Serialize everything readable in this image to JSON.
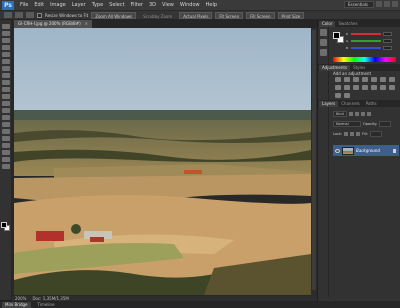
{
  "app": {
    "logo_text": "Ps",
    "menu": [
      "File",
      "Edit",
      "Image",
      "Layer",
      "Type",
      "Select",
      "Filter",
      "3D",
      "View",
      "Window",
      "Help"
    ],
    "workspace": "Essentials"
  },
  "options_bar": {
    "checkbox_label": "Resize Windows to Fit",
    "zoom_all_windows": "Zoom All Windows",
    "scrubby_zoom": "Scrubby Zoom",
    "actual_pixels": "Actual Pixels",
    "fit_screen": "Fit Screen",
    "fill_screen": "Fill Screen",
    "print_size": "Print Size"
  },
  "document": {
    "tab_label": "GI-CRH-I.jpg @ 200% (RGB/8#)",
    "close_glyph": "×",
    "zoom": "200%",
    "doc_info": "Doc: 1,35M/1,35M"
  },
  "bottom_bar": {
    "tabs": [
      "Mini Bridge",
      "Timeline"
    ]
  },
  "panels": {
    "color": {
      "tabs": [
        "Color",
        "Swatches"
      ],
      "channels": [
        {
          "label": "R",
          "color": "#d03030"
        },
        {
          "label": "G",
          "color": "#30a030"
        },
        {
          "label": "B",
          "color": "#3050d0"
        }
      ]
    },
    "adjustments": {
      "tabs": [
        "Adjustments",
        "Styles"
      ],
      "title": "Add an adjustment"
    },
    "layers": {
      "tabs": [
        "Layers",
        "Channels",
        "Paths"
      ],
      "kind": "Kind",
      "blend_mode": "Normal",
      "opacity_label": "Opacity:",
      "lock_label": "Lock:",
      "fill_label": "Fill:",
      "background_layer": "Background"
    }
  },
  "colors": {
    "ps_blue": "#2b6fb6",
    "selected_layer": "#3e5f8e",
    "sky": "#a4bacb",
    "field": "#c9a06a",
    "forest": "#3e4526"
  }
}
